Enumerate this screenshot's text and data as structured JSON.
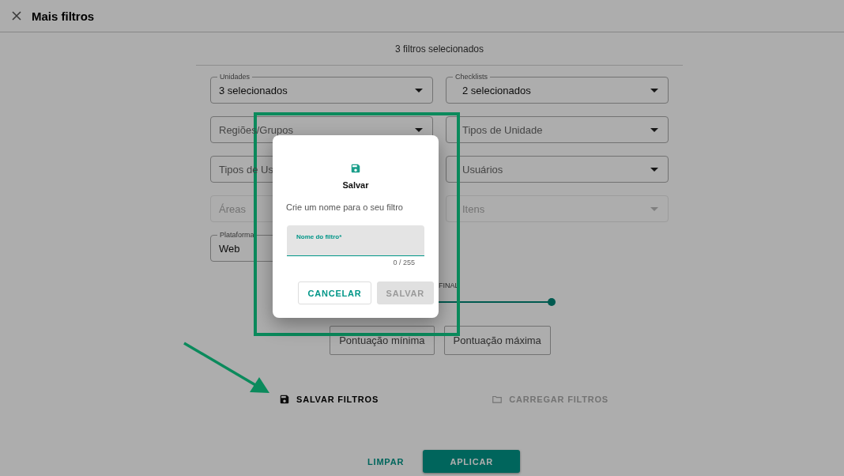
{
  "header": {
    "title": "Mais filtros"
  },
  "summary": "3 filtros selecionados",
  "filters": [
    {
      "label": "Unidades",
      "value": "3 selecionados",
      "disabled": false,
      "dropdown": true
    },
    {
      "label": "Checklists",
      "value": "2 selecionados",
      "disabled": false,
      "dropdown": true
    },
    {
      "placeholder": "Regiões/Grupos",
      "disabled": false,
      "dropdown": true
    },
    {
      "placeholder": "Tipos de Unidade",
      "disabled": false,
      "dropdown": true
    },
    {
      "placeholder": "Tipos de Us",
      "disabled": false,
      "dropdown": false
    },
    {
      "placeholder": "Usuários",
      "disabled": false,
      "dropdown": true
    },
    {
      "placeholder": "Áreas",
      "disabled": true,
      "dropdown": false
    },
    {
      "placeholder": "Itens",
      "disabled": true,
      "dropdown": true
    },
    {
      "label": "Plataforma",
      "value": "Web",
      "disabled": false,
      "dropdown": false
    }
  ],
  "slider": {
    "label": "FINAL",
    "level": 1
  },
  "score_buttons": [
    "Pontuação mínima",
    "Pontuação máxima"
  ],
  "file_actions": [
    {
      "label": "SALVAR FILTROS",
      "kind": "save",
      "disabled": false
    },
    {
      "label": "CARREGAR FILTROS",
      "kind": "load",
      "disabled": true
    }
  ],
  "footer": [
    {
      "label": "LIMPAR",
      "kind": "text"
    },
    {
      "label": "APLICAR",
      "kind": "filled"
    }
  ],
  "dialog": {
    "title": "Salvar",
    "message": "Crie um nome para o seu filtro",
    "field": {
      "label": "Nome do filtro*",
      "counter": "0 / 255"
    },
    "buttons": [
      {
        "label": "CANCELAR",
        "disabled": false
      },
      {
        "label": "SALVAR",
        "disabled": true
      }
    ]
  }
}
